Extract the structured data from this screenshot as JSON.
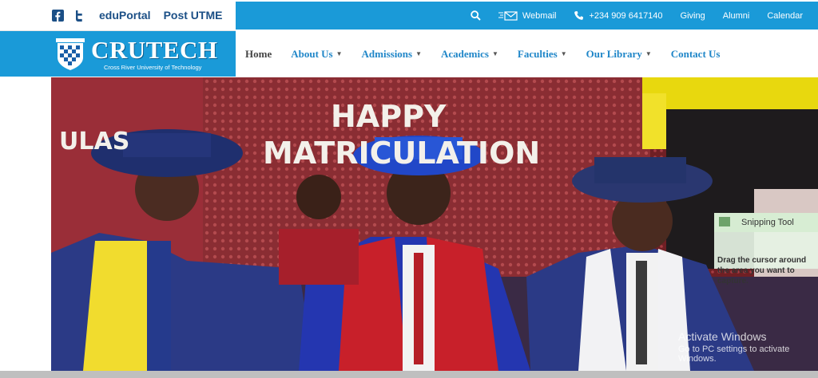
{
  "topbar": {
    "quick_links": [
      {
        "label": "eduPortal"
      },
      {
        "label": "Post UTME"
      }
    ],
    "webmail_label": "Webmail",
    "phone_label": "+234 909 6417140",
    "links": [
      {
        "label": "Giving"
      },
      {
        "label": "Alumni"
      },
      {
        "label": "Calendar"
      }
    ]
  },
  "logo": {
    "name": "CRUTECH",
    "subtitle": "Cross River University of Technology"
  },
  "nav": {
    "items": [
      {
        "label": "Home",
        "dropdown": false
      },
      {
        "label": "About Us",
        "dropdown": true
      },
      {
        "label": "Admissions",
        "dropdown": true
      },
      {
        "label": "Academics",
        "dropdown": true
      },
      {
        "label": "Faculties",
        "dropdown": true
      },
      {
        "label": "Our Library",
        "dropdown": true
      },
      {
        "label": "Contact Us",
        "dropdown": false
      }
    ]
  },
  "hero": {
    "banner_line1": "HAPPY",
    "banner_line2": "MATRICULATION",
    "left_fragment": "ULAS"
  },
  "overlay": {
    "snip_title": "Snipping Tool",
    "snip_text": "Drag the cursor around the area you want to capture.",
    "activate_line1": "Activate Windows",
    "activate_line2": "Go to PC settings to activate Windows."
  },
  "colors": {
    "brand_blue": "#1a9ad8",
    "nav_text": "#1f86c8",
    "quick_link": "#1b4f86"
  }
}
